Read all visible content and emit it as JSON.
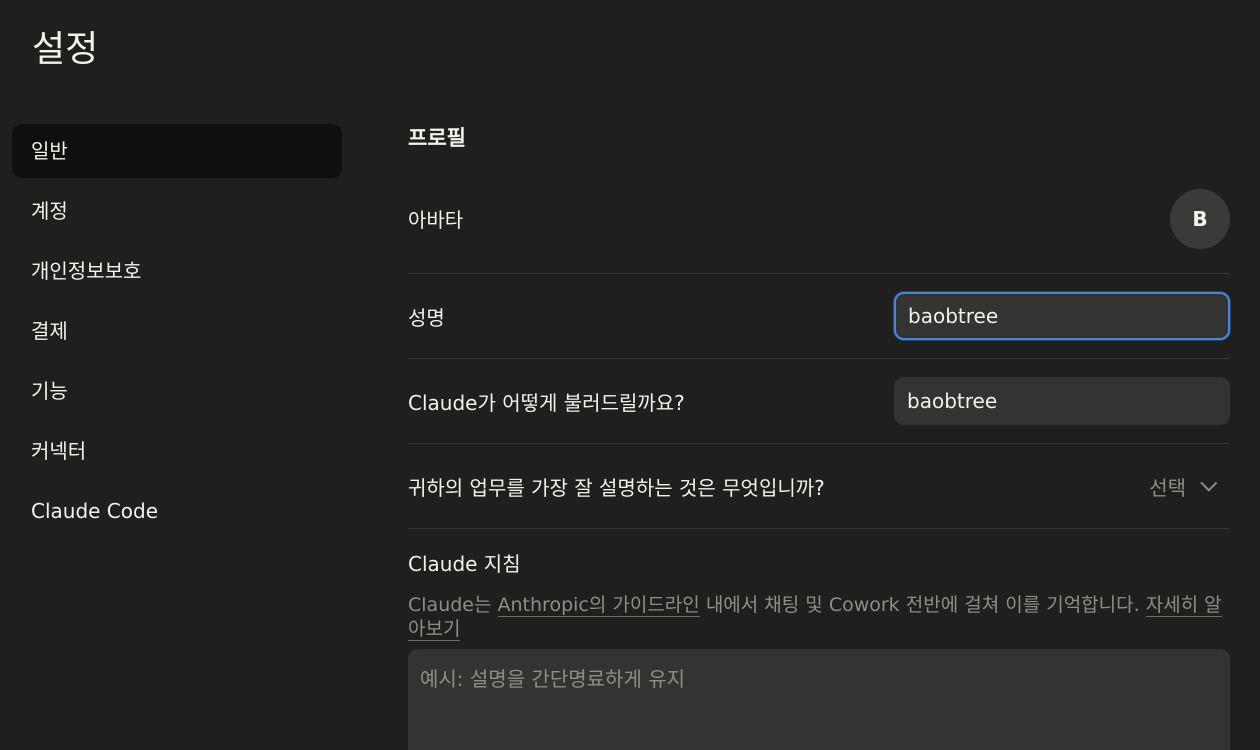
{
  "page": {
    "title": "설정"
  },
  "sidebar": {
    "items": [
      {
        "label": "일반",
        "active": true
      },
      {
        "label": "계정"
      },
      {
        "label": "개인정보보호"
      },
      {
        "label": "결제"
      },
      {
        "label": "기능"
      },
      {
        "label": "커넥터"
      },
      {
        "label": "Claude Code"
      }
    ]
  },
  "profile": {
    "section_title": "프로필",
    "avatar_label": "아바타",
    "avatar_initial": "B",
    "full_name_label": "성명",
    "full_name_value": "baobtree",
    "nickname_label": "Claude가 어떻게 불러드릴까요?",
    "nickname_value": "baobtree",
    "work_label": "귀하의 업무를 가장 잘 설명하는 것은 무엇입니까?",
    "work_select_value": "선택"
  },
  "instructions": {
    "title": "Claude 지침",
    "helper_part1": "Claude는 ",
    "helper_link1": "Anthropic의 가이드라인",
    "helper_part2": " 내에서 채팅 및 Cowork 전반에 걸쳐 이를 기억합니다. ",
    "helper_link2": "자세히 알아보기",
    "placeholder": "예시: 설명을 간단명료하게 유지"
  }
}
